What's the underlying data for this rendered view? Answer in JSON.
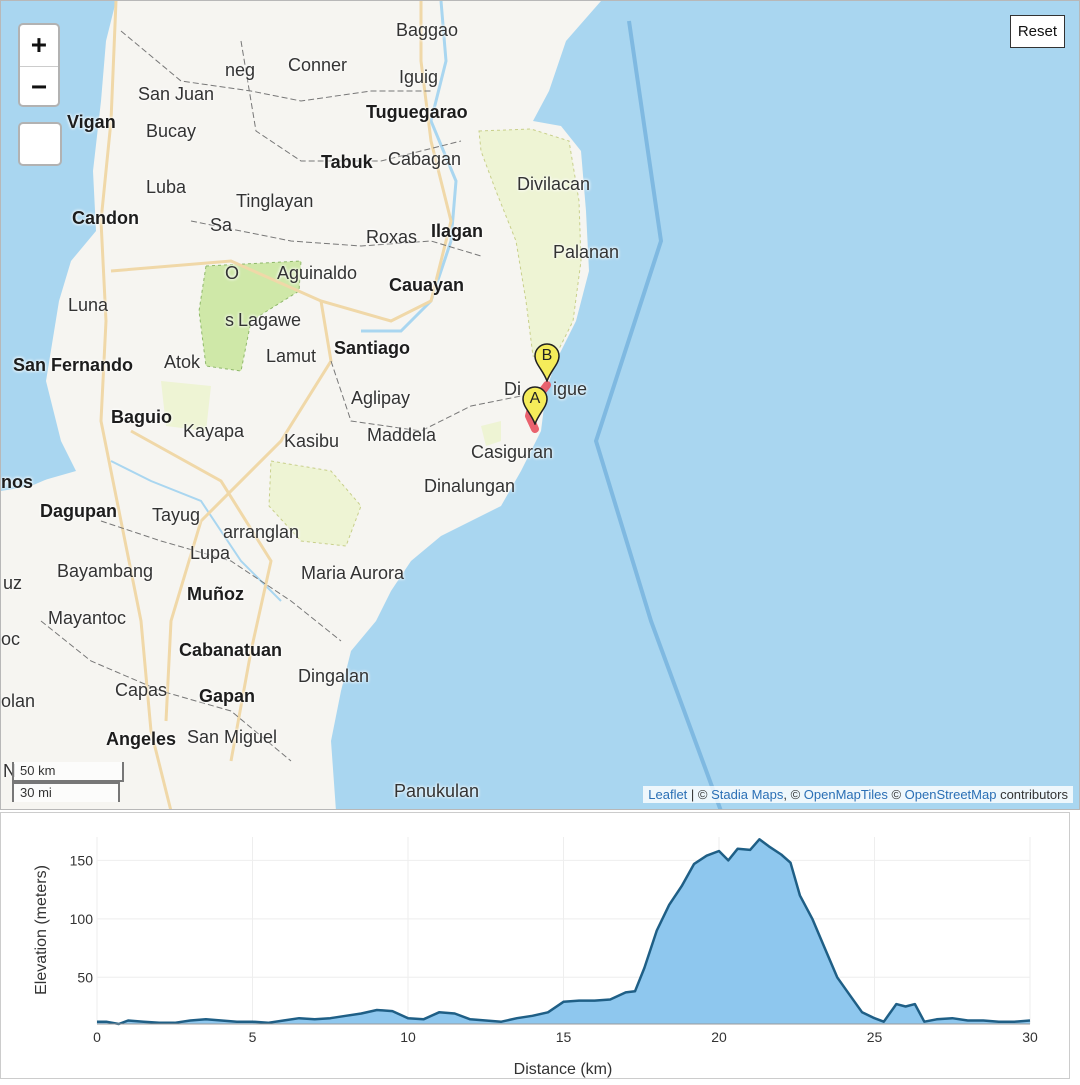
{
  "map": {
    "zoom_in": "+",
    "zoom_out": "−",
    "reset_label": "Reset",
    "scale_km": "50 km",
    "scale_mi": "30 mi",
    "attribution": {
      "leaflet": "Leaflet",
      "sep1": " | © ",
      "stadia": "Stadia Maps",
      "sep2": ", © ",
      "omt": "OpenMapTiles",
      "sep3": " © ",
      "osm": "OpenStreetMap",
      "tail": " contributors"
    },
    "marker_a": "A",
    "marker_b": "B",
    "places": {
      "baggao": "Baggao",
      "neg": "neg",
      "conner": "Conner",
      "iguig": "Iguig",
      "san_juan": "San Juan",
      "tuguegarao": "Tuguegarao",
      "vigan": "Vigan",
      "bucay": "Bucay",
      "tabuk": "Tabuk",
      "cabagan": "Cabagan",
      "luba": "Luba",
      "divilacan": "Divilacan",
      "candon": "Candon",
      "tinglayan": "Tinglayan",
      "sa": "Sa",
      "roxas": "Roxas",
      "ilagan": "Ilagan",
      "palanan": "Palanan",
      "o": "O",
      "aguinaldo": "Aguinaldo",
      "cauayan": "Cauayan",
      "luna": "Luna",
      "s": "s",
      "lagawe": "Lagawe",
      "lamut": "Lamut",
      "santiago": "Santiago",
      "san_fernando": "San Fernando",
      "atok": "Atok",
      "dinapigue_a": "Di",
      "dinapigue_b": "igue",
      "aglipay": "Aglipay",
      "baguio": "Baguio",
      "kayapa": "Kayapa",
      "kasibu": "Kasibu",
      "maddela": "Maddela",
      "casiguran": "Casiguran",
      "nos": "nos",
      "dinalungan": "Dinalungan",
      "dagupan": "Dagupan",
      "tayug": "Tayug",
      "arranglan": "arranglan",
      "lupa": "Lupa",
      "bayambang": "Bayambang",
      "maria_aurora": "Maria Aurora",
      "uz": "uz",
      "munoz": "Muñoz",
      "mayantoc": "Mayantoc",
      "oc": "oc",
      "cabanatuan": "Cabanatuan",
      "dingalan": "Dingalan",
      "capas": "Capas",
      "gapan": "Gapan",
      "olan": "olan",
      "angeles": "Angeles",
      "san_miguel": "San Miguel",
      "panukulan": "Panukulan",
      "n": "N"
    }
  },
  "chart_data": {
    "type": "area",
    "xlabel": "Distance (km)",
    "ylabel": "Elevation (meters)",
    "xlim": [
      0,
      30
    ],
    "ylim": [
      10,
      170
    ],
    "x_ticks": [
      0,
      5,
      10,
      15,
      20,
      25,
      30
    ],
    "y_ticks": [
      50,
      100,
      150
    ],
    "grid": true,
    "fill_color": "#8ec7ee",
    "line_color": "#1f5f86",
    "x": [
      0,
      0.3,
      0.7,
      1,
      1.5,
      2,
      2.5,
      3,
      3.5,
      4,
      4.5,
      5,
      5.5,
      6,
      6.5,
      7,
      7.5,
      8,
      8.5,
      9,
      9.5,
      10,
      10.5,
      11,
      11.5,
      12,
      12.5,
      13,
      13.5,
      14,
      14.5,
      15,
      15.5,
      16,
      16.5,
      17,
      17.3,
      17.6,
      18,
      18.4,
      18.8,
      19.2,
      19.6,
      20,
      20.3,
      20.6,
      21,
      21.3,
      21.6,
      22,
      22.3,
      22.6,
      23,
      23.4,
      23.8,
      24.2,
      24.6,
      25,
      25.3,
      25.7,
      26,
      26.3,
      26.6,
      27,
      27.5,
      28,
      28.5,
      29,
      29.5,
      30
    ],
    "y": [
      12,
      12,
      10,
      13,
      12,
      11,
      11,
      13,
      14,
      13,
      12,
      12,
      11,
      13,
      15,
      14,
      15,
      17,
      19,
      22,
      21,
      15,
      14,
      20,
      19,
      14,
      13,
      12,
      15,
      17,
      20,
      29,
      30,
      30,
      31,
      37,
      38,
      58,
      90,
      112,
      128,
      147,
      154,
      158,
      150,
      160,
      159,
      168,
      162,
      155,
      148,
      120,
      100,
      75,
      50,
      35,
      20,
      15,
      12,
      27,
      25,
      27,
      12,
      14,
      15,
      13,
      13,
      12,
      12,
      13
    ]
  }
}
